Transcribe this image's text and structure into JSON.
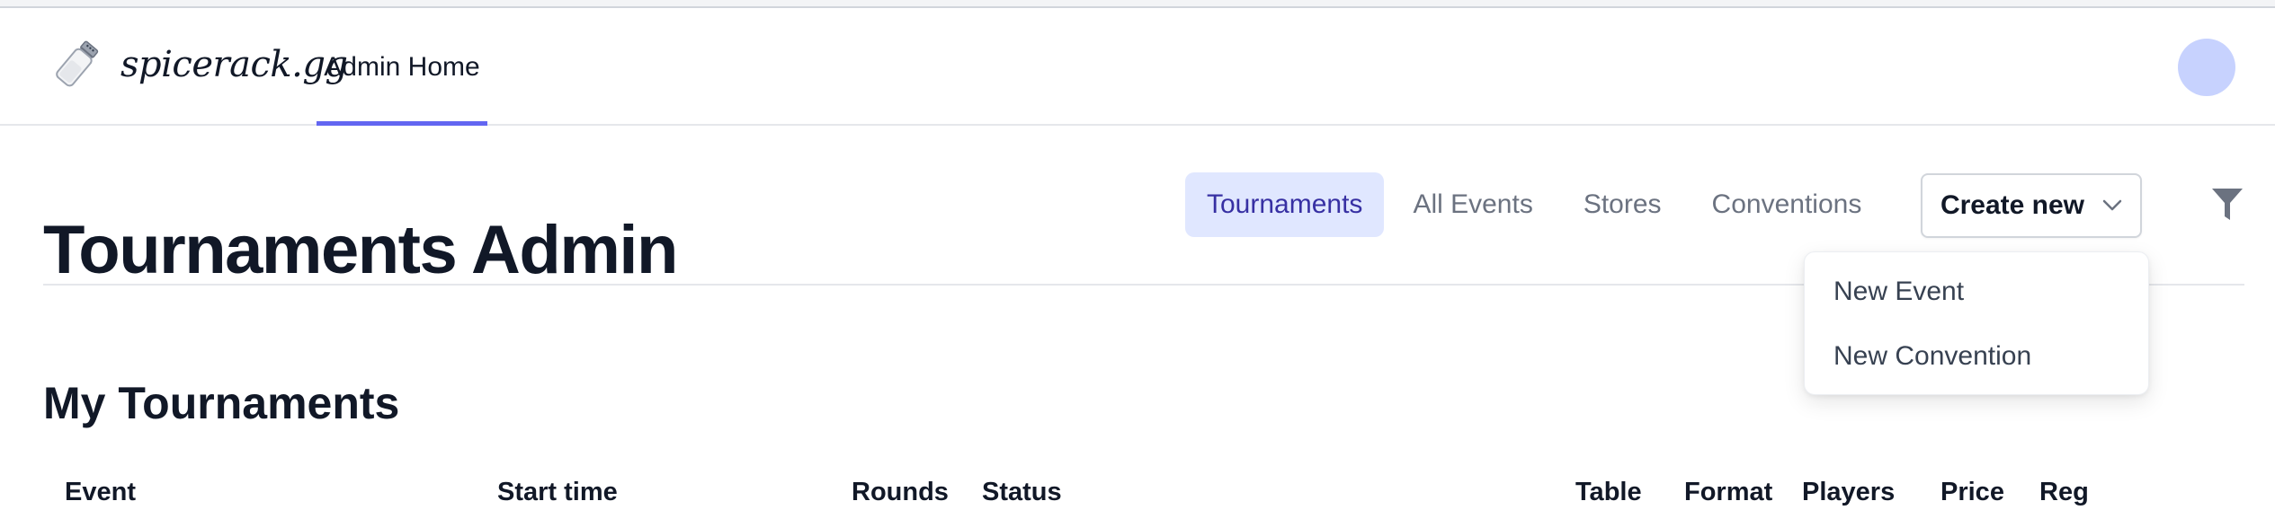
{
  "brand": {
    "name": "spicerack.gg",
    "logo_icon": "salt-shaker-icon"
  },
  "nav": {
    "admin_home": "Admin Home",
    "accent_color": "#6366f1"
  },
  "page": {
    "title": "Tournaments Admin"
  },
  "tabs": [
    {
      "label": "Tournaments",
      "active": true
    },
    {
      "label": "All Events",
      "active": false
    },
    {
      "label": "Stores",
      "active": false
    },
    {
      "label": "Conventions",
      "active": false
    }
  ],
  "create_menu": {
    "button_label": "Create new",
    "icon": "chevron-down-icon",
    "items": [
      "New Event",
      "New Convention"
    ]
  },
  "filter": {
    "icon": "filter-icon"
  },
  "section": {
    "title": "My Tournaments"
  },
  "table": {
    "columns": [
      "Event",
      "Start time",
      "Rounds",
      "Status",
      "Table",
      "Format",
      "Players",
      "Price",
      "Reg"
    ]
  },
  "colors": {
    "tab_active_bg": "#e0e7ff",
    "tab_active_text": "#3730a3",
    "avatar": "#c7d2fe"
  }
}
